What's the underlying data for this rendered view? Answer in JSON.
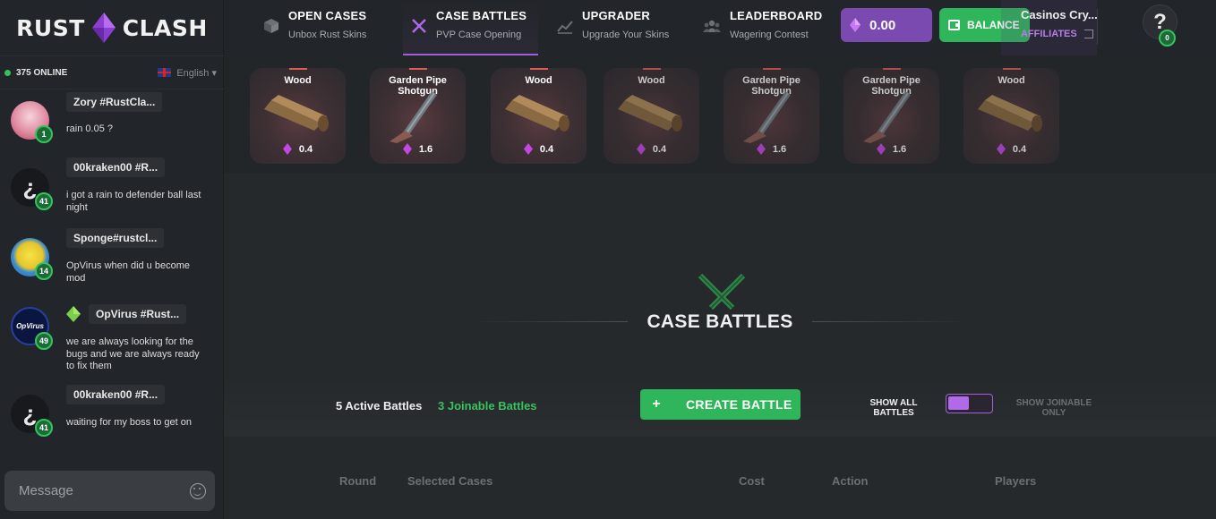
{
  "logo": {
    "left": "RUST",
    "right": "CLASH"
  },
  "online": {
    "count_text": "375 ONLINE",
    "language": "English ▾"
  },
  "nav": [
    {
      "title": "OPEN CASES",
      "sub": "Unbox Rust Skins",
      "icon": "cube-icon"
    },
    {
      "title": "CASE BATTLES",
      "sub": "PVP Case Opening",
      "icon": "crossed-swords-icon",
      "active": true
    },
    {
      "title": "UPGRADER",
      "sub": "Upgrade Your Skins",
      "icon": "chart-up-icon"
    },
    {
      "title": "LEADERBOARD",
      "sub": "Wagering Contest",
      "icon": "users-icon"
    }
  ],
  "account": {
    "balance": "0.00",
    "balance_button": "BALANCE",
    "user_name": "Casinos Cry...",
    "affiliates": "AFFILIATES",
    "help": "?",
    "notifications": "0"
  },
  "drops": [
    {
      "name": "Wood",
      "price": "0.4",
      "item": "wood-icon"
    },
    {
      "name": "Garden Pipe Shotgun",
      "price": "1.6",
      "item": "shotgun-icon"
    },
    {
      "name": "Wood",
      "price": "0.4",
      "item": "wood-icon"
    },
    {
      "name": "Wood",
      "price": "0.4",
      "item": "wood-icon"
    },
    {
      "name": "Garden Pipe Shotgun",
      "price": "1.6",
      "item": "shotgun-icon"
    },
    {
      "name": "Garden Pipe Shotgun",
      "price": "1.6",
      "item": "shotgun-icon"
    },
    {
      "name": "Wood",
      "price": "0.4",
      "item": "wood-icon"
    }
  ],
  "chat": [
    {
      "user": "Zory #RustCla...",
      "level": "1",
      "text": "rain 0.05 ?",
      "avatar": "anime-girl-avatar",
      "avatar_color": "#e3c6cf"
    },
    {
      "user": "00kraken00 #R...",
      "level": "41",
      "text": "i got a rain to defender ball last night",
      "avatar": "hook-avatar",
      "avatar_color": "#1a1c1f"
    },
    {
      "user": "Sponge#rustcl...",
      "level": "14",
      "text": "OpVirus when did u become mod",
      "avatar": "sponge-avatar",
      "avatar_color": "#3aa0e0"
    },
    {
      "user": "OpVirus #Rust...",
      "level": "49",
      "text": "we are always looking for the bugs and we are always ready to fix them",
      "avatar": "opvirus-avatar",
      "avatar_color": "#0b1640",
      "mod": true
    },
    {
      "user": "00kraken00 #R...",
      "level": "41",
      "text": "waiting for my boss to get on",
      "avatar": "hook-avatar",
      "avatar_color": "#1a1c1f"
    }
  ],
  "chat_input": {
    "placeholder": "Message"
  },
  "main": {
    "title": "CASE BATTLES",
    "active_battles": "5 Active Battles",
    "joinable_battles": "3 Joinable Battles",
    "create_plus": "+",
    "create_label": "CREATE BATTLE",
    "toggle_left": "SHOW ALL BATTLES",
    "toggle_right": "SHOW JOINABLE ONLY",
    "columns": [
      "Round",
      "Selected Cases",
      "Cost",
      "Action",
      "Players"
    ]
  },
  "colors": {
    "accent_purple": "#9f5fd6",
    "accent_green": "#2fb55a",
    "background": "#26292c"
  }
}
